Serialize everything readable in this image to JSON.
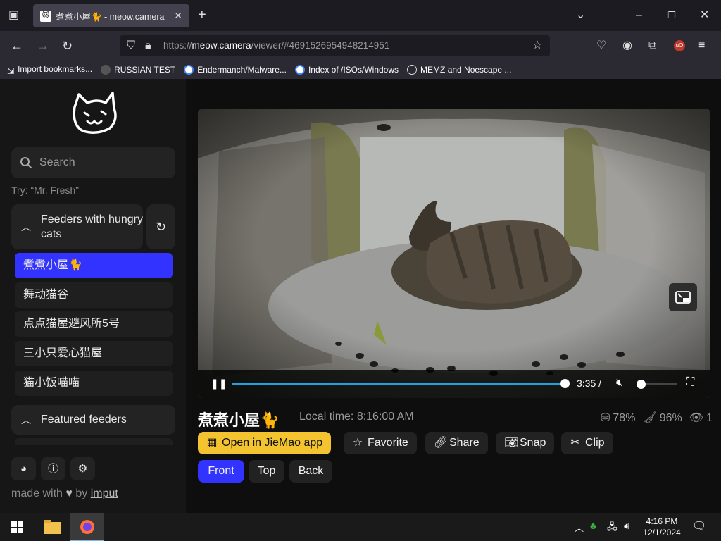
{
  "browser": {
    "tab_title": "煮煮小屋🐈 - meow.camera",
    "url_host_prefix": "https://",
    "url_host": "meow.camera",
    "url_path": "/viewer/#4691526954948214951",
    "bookmarks": [
      {
        "label": "Import bookmarks...",
        "icon": "import-icon"
      },
      {
        "label": "RUSSIAN TEST",
        "icon": "site-icon"
      },
      {
        "label": "Endermanch/Malware...",
        "icon": "google-icon"
      },
      {
        "label": "Index of /ISOs/Windows",
        "icon": "google-icon"
      },
      {
        "label": "MEMZ and Noescape ...",
        "icon": "globe-icon"
      }
    ]
  },
  "sidebar": {
    "search_placeholder": "Search",
    "hint": "Try: “Mr. Fresh”",
    "group1_title": "Feeders with hungry cats",
    "feeders": [
      {
        "label": "煮煮小屋🐈",
        "active": true
      },
      {
        "label": "舞动猫谷",
        "active": false
      },
      {
        "label": "点点猫屋避风所5号",
        "active": false
      },
      {
        "label": "三小只爱心猫屋",
        "active": false
      },
      {
        "label": "猫小饭喵喵",
        "active": false
      }
    ],
    "group2_title": "Featured feeders",
    "made_with_prefix": "made with",
    "made_with_by": "by",
    "made_with_link": "imput"
  },
  "player": {
    "time": "3:35 /",
    "progress": 0.998,
    "volume": 0.0
  },
  "info": {
    "camera_name": "煮煮小屋🐈",
    "local_time": "Local time: 8:16:00 AM",
    "food_level": "78%",
    "cleanliness": "96%",
    "viewers": "1"
  },
  "actions": {
    "open_app": "Open in JieMao app",
    "favorite": "Favorite",
    "share": "Share",
    "snap": "Snap",
    "clip": "Clip"
  },
  "views": [
    "Front",
    "Top",
    "Back"
  ],
  "taskbar": {
    "time": "4:16 PM",
    "date": "12/1/2024"
  }
}
